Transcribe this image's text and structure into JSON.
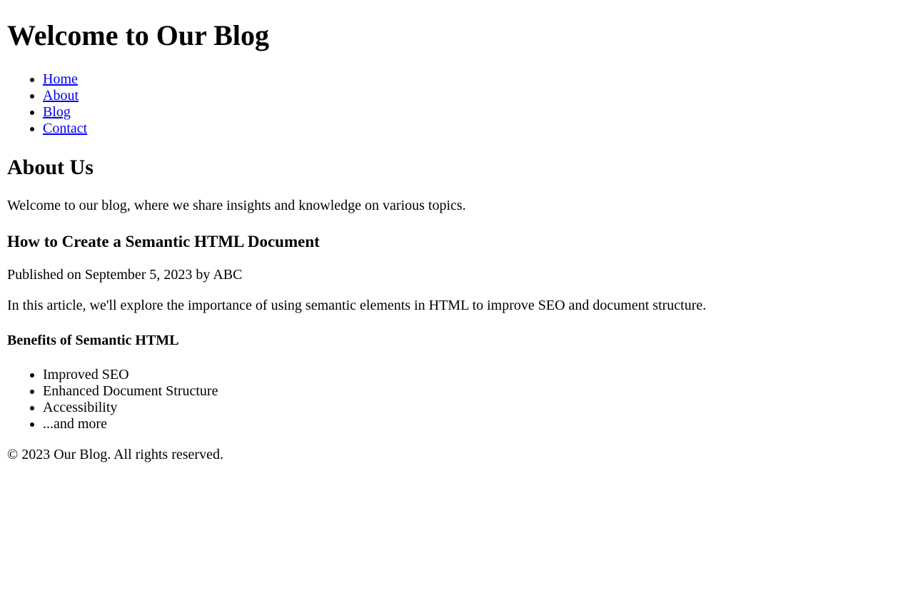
{
  "header": {
    "title": "Welcome to Our Blog"
  },
  "nav": {
    "items": [
      {
        "label": "Home"
      },
      {
        "label": "About"
      },
      {
        "label": "Blog"
      },
      {
        "label": "Contact"
      }
    ]
  },
  "about": {
    "heading": "About Us",
    "text": "Welcome to our blog, where we share insights and knowledge on various topics."
  },
  "article": {
    "title": "How to Create a Semantic HTML Document",
    "meta": "Published on September 5, 2023 by ABC",
    "intro": "In this article, we'll explore the importance of using semantic elements in HTML to improve SEO and document structure.",
    "benefits": {
      "heading": "Benefits of Semantic HTML",
      "items": [
        "Improved SEO",
        "Enhanced Document Structure",
        "Accessibility",
        "...and more"
      ]
    }
  },
  "footer": {
    "text": "© 2023 Our Blog. All rights reserved."
  },
  "colors": {
    "link": "#0000ee",
    "text": "#000000",
    "background": "#ffffff"
  }
}
